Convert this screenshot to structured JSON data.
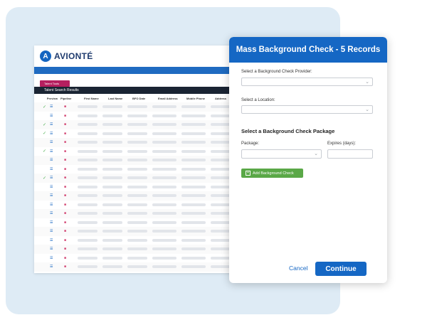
{
  "brand": {
    "name": "AVIONTÉ",
    "mark": "A"
  },
  "app": {
    "tab_label": "Talent Tools",
    "results_title": "Talent Search Results",
    "columns": [
      "Preview",
      "Pipeline",
      "First Name",
      "Last Name",
      "BFO Date",
      "Email Address",
      "Mobile Phone",
      "Address"
    ],
    "rows": [
      {
        "checked": true
      },
      {
        "checked": false
      },
      {
        "checked": true
      },
      {
        "checked": true
      },
      {
        "checked": false
      },
      {
        "checked": true
      },
      {
        "checked": false
      },
      {
        "checked": false
      },
      {
        "checked": true
      },
      {
        "checked": false
      },
      {
        "checked": false
      },
      {
        "checked": false
      },
      {
        "checked": false
      },
      {
        "checked": false
      },
      {
        "checked": false
      },
      {
        "checked": false
      },
      {
        "checked": false
      },
      {
        "checked": false
      },
      {
        "checked": false
      }
    ]
  },
  "modal": {
    "title": "Mass Background Check - 5 Records",
    "provider_label": "Select a Background Check Provider:",
    "location_label": "Select a Location:",
    "package_section": "Select a Background Check Package",
    "package_label": "Package:",
    "expires_label": "Expires (days):",
    "add_button": "Add Background Check",
    "cancel": "Cancel",
    "continue": "Continue"
  },
  "colors": {
    "primary": "#1567c4",
    "accent_pink": "#b51f5f",
    "green": "#5aa847",
    "backdrop": "#deebf5"
  }
}
